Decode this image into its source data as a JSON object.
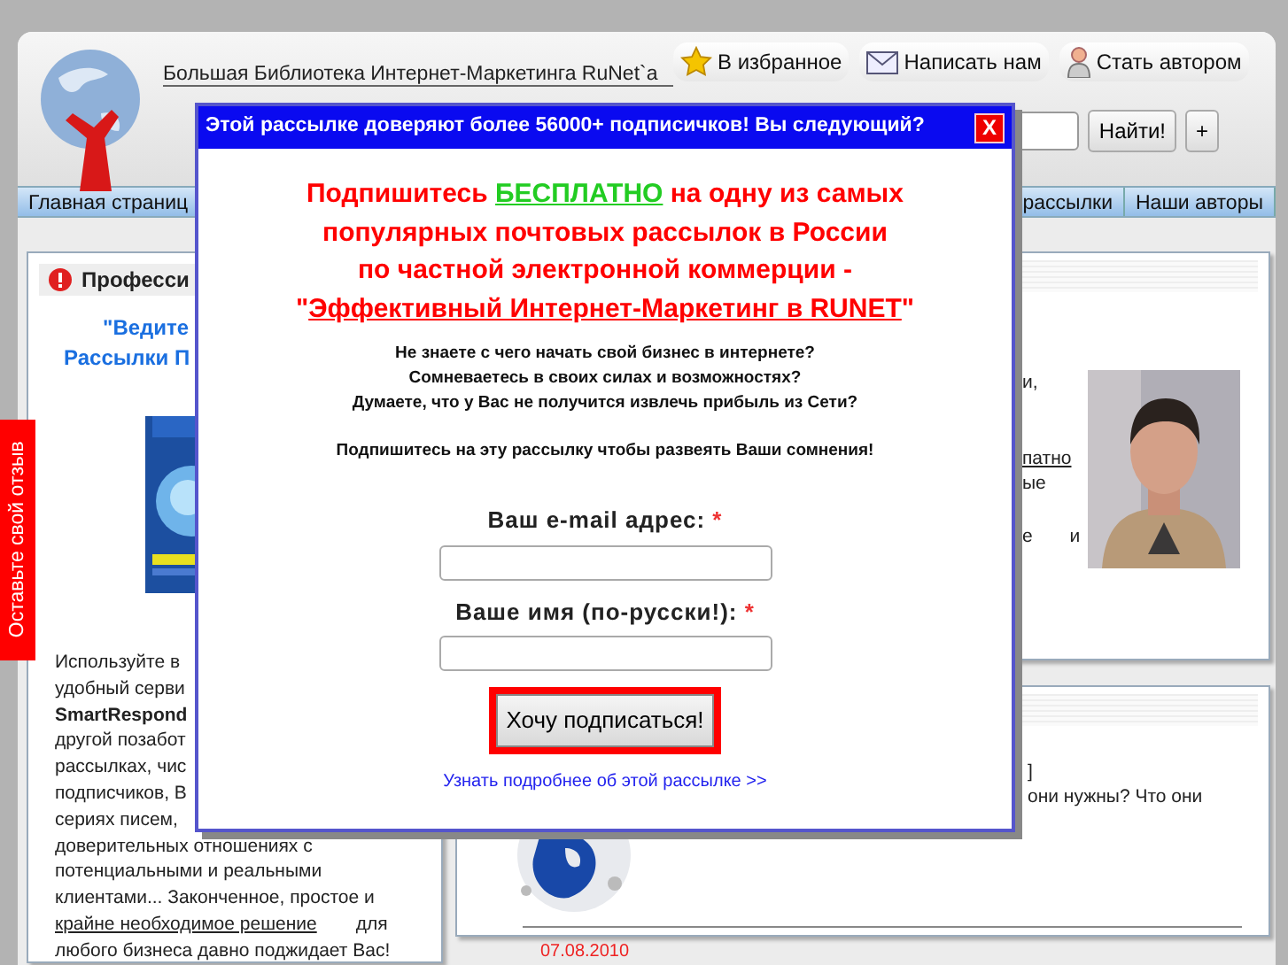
{
  "site_header": {
    "tagline": "Большая Библиотека Интернет-Маркетинга RuNet`a",
    "top_links": [
      {
        "label": "В избранное",
        "kind": "star"
      },
      {
        "label": "Написать нам",
        "kind": "mail"
      },
      {
        "label": "Стать автором",
        "kind": "person"
      }
    ]
  },
  "search": {
    "button": "Найти!",
    "extra_button": "+"
  },
  "nav": {
    "left_items": [
      "Главная страниц"
    ],
    "right_items": [
      "рассылки",
      "Наши авторы"
    ]
  },
  "feedback_tab": "Оставьте свой отзыв",
  "left_panel": {
    "title": "Професси",
    "headline": [
      "\"Ведите",
      "Рассылки П"
    ],
    "text_lines": [
      {
        "kind": "plain",
        "text": "Используйте в"
      },
      {
        "kind": "plain",
        "text": "удобный серви"
      },
      {
        "kind": "bold",
        "text": "SmartRespond"
      },
      {
        "kind": "plain",
        "text": "другой позабот"
      },
      {
        "kind": "plain",
        "text": "рассылках, чис"
      },
      {
        "kind": "plain",
        "text": "подписчиков, В"
      },
      {
        "kind": "plain",
        "text": "сериях писем,"
      },
      {
        "kind": "plain",
        "text": "доверительных отношениях с"
      },
      {
        "kind": "plain",
        "text": "потенциальными и реальными"
      },
      {
        "kind": "plain",
        "text": "клиентами... Законченное, простое и"
      },
      {
        "kind": "link",
        "text": "крайне необходимое решение",
        "after": "для"
      },
      {
        "kind": "plain",
        "text": "любого бизнеса давно поджидает Вас!"
      }
    ]
  },
  "side_panel": {
    "fragments": [
      {
        "kind": "plain",
        "text": "и,"
      },
      {
        "kind": "link",
        "text": "патно"
      },
      {
        "kind": "plain",
        "text": "ые"
      },
      {
        "kind": "plain",
        "text": "е и"
      }
    ]
  },
  "news_panel": {
    "fragments": [
      "]",
      "они нужны? Что они"
    ],
    "date": "07.08.2010"
  },
  "modal": {
    "title": "Этой рассылке доверяют более 56000+ подписичков! Вы следующий?",
    "close": "X",
    "headline": [
      [
        {
          "kind": "plain",
          "text": "Подпишитесь "
        },
        {
          "kind": "free",
          "text": "БЕСПЛАТНО"
        },
        {
          "kind": "plain",
          "text": " на одну из самых"
        }
      ],
      [
        {
          "kind": "plain",
          "text": "популярных почтовых рассылок в России"
        }
      ],
      [
        {
          "kind": "plain",
          "text": "по частной электронной коммерции -"
        }
      ],
      [
        {
          "kind": "plain",
          "text": "\""
        },
        {
          "kind": "title",
          "text": "Эффективный Интернет-Маркетинг в RUNET"
        },
        {
          "kind": "plain",
          "text": "\""
        }
      ]
    ],
    "questions": [
      "Не знаете с чего начать свой бизнес в интернете?",
      "Сомневаетесь в своих силах и возможностях?",
      "Думаете, что у Вас не получится извлечь прибыль из Сети?"
    ],
    "call": "Подпишитесь на эту рассылку чтобы развеять Ваши сомнения!",
    "fields": [
      {
        "label": "Ваш e-mail адрес:",
        "required_mark": "*"
      },
      {
        "label": "Ваше имя (по-русски!):",
        "required_mark": "*"
      }
    ],
    "button": "Хочу подписаться!",
    "more_link": "Узнать подробнее об этой рассылке >>"
  }
}
